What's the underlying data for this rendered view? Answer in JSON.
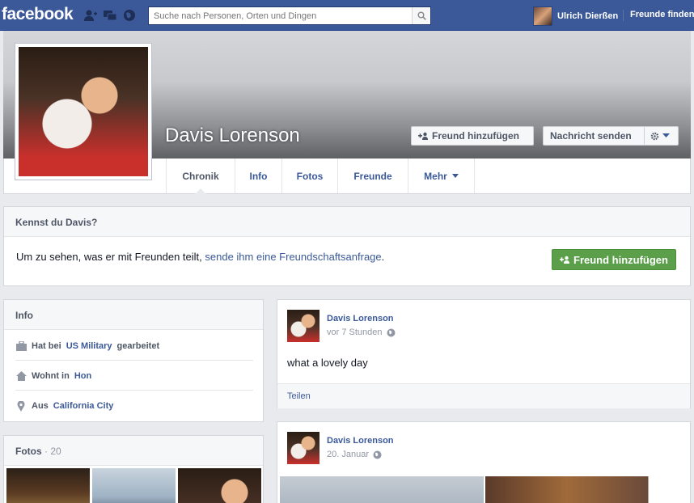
{
  "topbar": {
    "logo": "facebook",
    "search_placeholder": "Suche nach Personen, Orten und Dingen",
    "user_name": "Ulrich Dierßen",
    "find_friends": "Freunde finden"
  },
  "profile": {
    "name": "Davis Lorenson",
    "add_friend": "Freund hinzufügen",
    "send_message": "Nachricht senden"
  },
  "tabs": [
    {
      "label": "Chronik"
    },
    {
      "label": "Info"
    },
    {
      "label": "Fotos"
    },
    {
      "label": "Freunde"
    },
    {
      "label": "Mehr"
    }
  ],
  "kennst": {
    "title": "Kennst du Davis?",
    "text": "Um zu sehen, was er mit Freunden teilt,",
    "link": "sende ihm eine Freundschaftsanfrage",
    "period": ".",
    "button": "Freund hinzufügen"
  },
  "info": {
    "title": "Info",
    "rows": [
      {
        "pre": "Hat bei",
        "link": "US Military",
        "post": "gearbeitet",
        "icon": "briefcase-icon"
      },
      {
        "pre": "Wohnt in",
        "link": "Hon",
        "post": "",
        "icon": "home-icon"
      },
      {
        "pre": "Aus",
        "link": "California City",
        "post": "",
        "icon": "location-pin-icon"
      }
    ]
  },
  "fotos": {
    "title": "Fotos",
    "count": "· 20"
  },
  "posts": [
    {
      "author": "Davis Lorenson",
      "time": "vor 7 Stunden",
      "text": "what a lovely day",
      "share": "Teilen"
    },
    {
      "author": "Davis Lorenson",
      "time": "20. Januar"
    }
  ],
  "colors": {
    "brand": "#3b5998",
    "green_button": "#5b9f4a"
  }
}
